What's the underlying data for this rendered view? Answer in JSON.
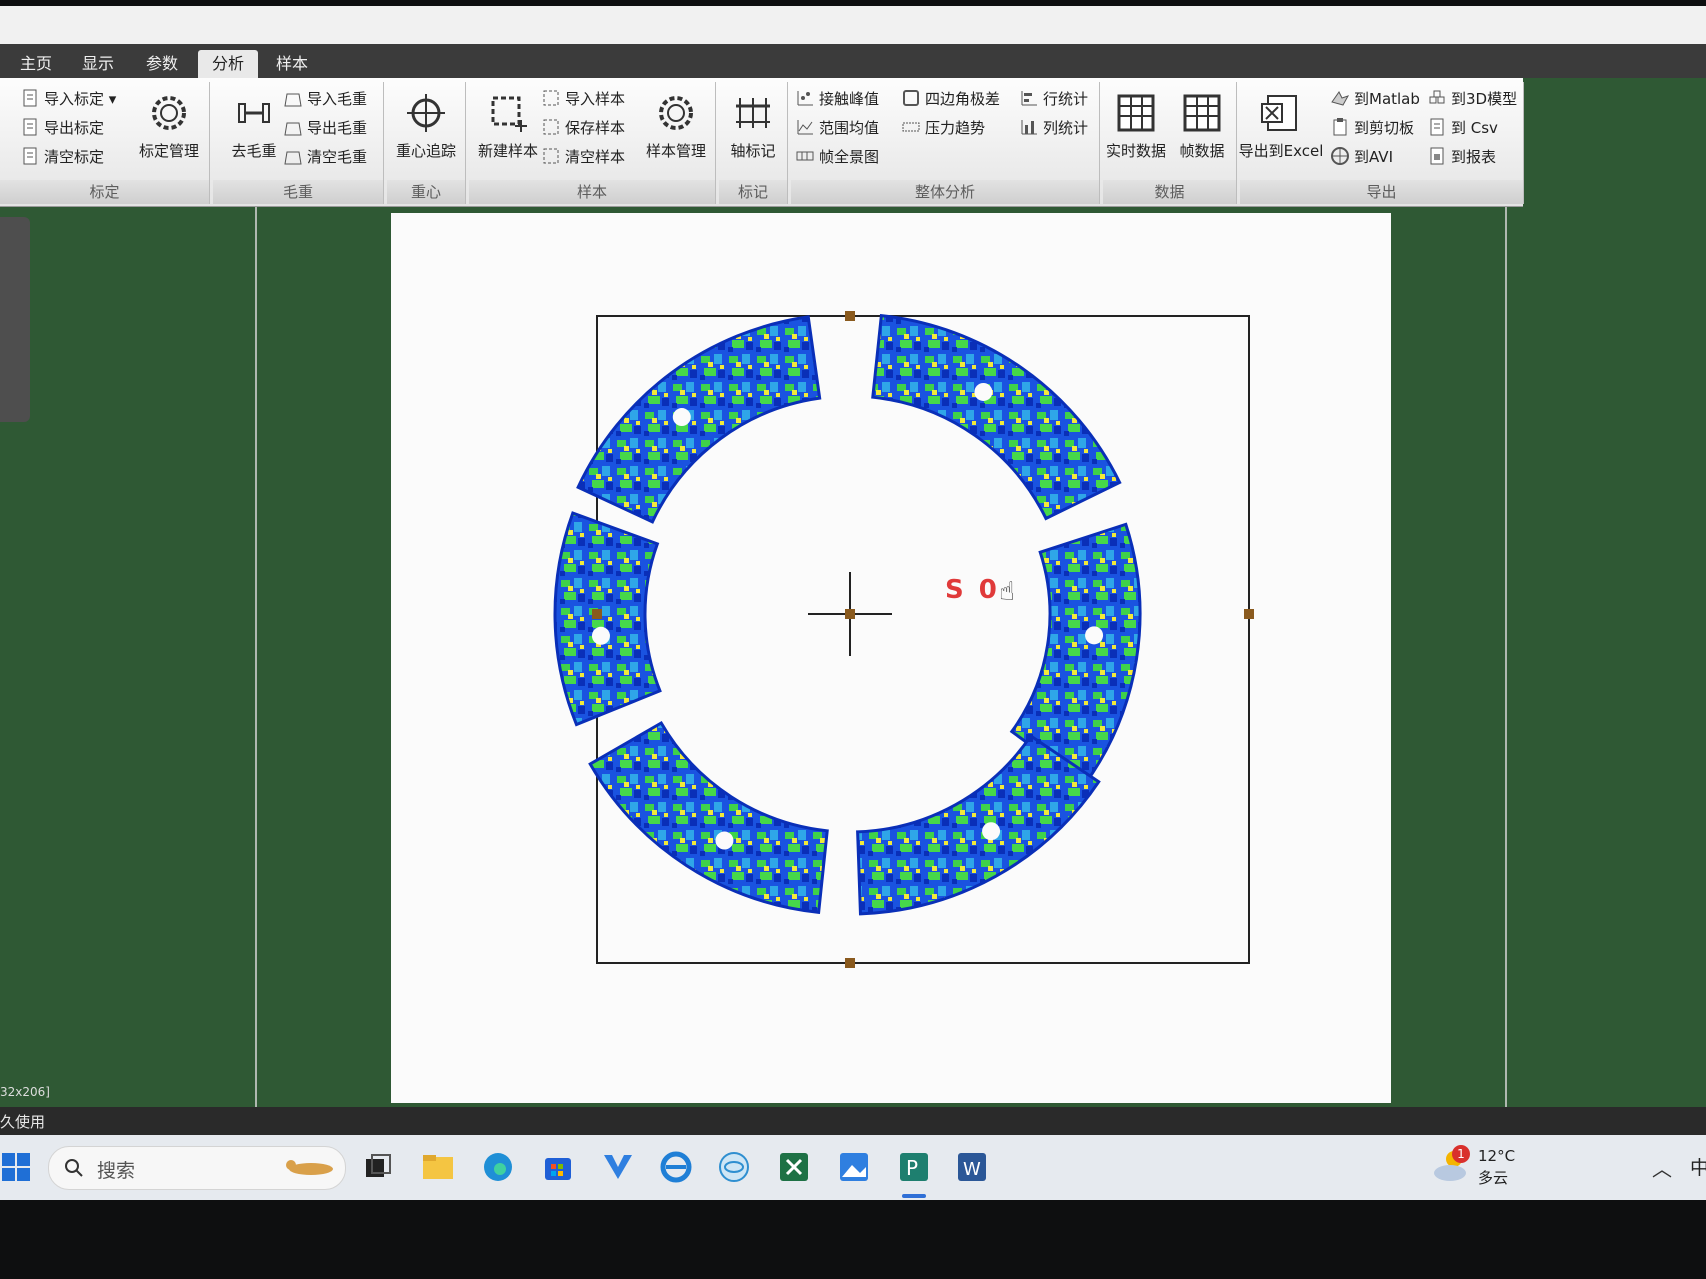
{
  "tabs": [
    "主页",
    "显示",
    "参数",
    "分析",
    "样本"
  ],
  "active_tab": "分析",
  "ribbon": {
    "calib": {
      "import": "导入标定",
      "export": "导出标定",
      "clear": "清空标定",
      "manage": "标定管理",
      "group": "标定"
    },
    "tare": {
      "remove": "去毛重",
      "import": "导入毛重",
      "export": "导出毛重",
      "clear": "清空毛重",
      "group": "毛重"
    },
    "cog": {
      "track": "重心追踪",
      "group": "重心"
    },
    "sample": {
      "new": "新建样本",
      "import": "导入样本",
      "save": "保存样本",
      "clear": "清空样本",
      "manage": "样本管理",
      "group": "样本"
    },
    "mark": {
      "axis": "轴标记",
      "group": "标记"
    },
    "whole": {
      "peak": "接触峰值",
      "range_avg": "范围均值",
      "frame_panorama": "帧全景图",
      "quad_diff": "四边角极差",
      "pressure_trend": "压力趋势",
      "row_stats": "行统计",
      "col_stats": "列统计",
      "group": "整体分析"
    },
    "data": {
      "realtime": "实时数据",
      "frame": "帧数据",
      "group": "数据"
    },
    "export": {
      "excel": "导出到Excel",
      "matlab": "到Matlab",
      "clipboard": "到剪切板",
      "avi": "到AVI",
      "model3d": "到3D模型",
      "csv": "到 Csv",
      "report": "到报表",
      "group": "导出"
    }
  },
  "canvas": {
    "marker_label": "S 0",
    "size_text": "32x206]"
  },
  "status_text": "久使用",
  "taskbar": {
    "search_placeholder": "搜索",
    "weather_temp": "12°C",
    "weather_cond": "多云",
    "badge": "1",
    "ime": "中"
  },
  "colors": {
    "accent_label": "#e03a3a",
    "heat_low": "#0a2fb8",
    "heat_mid": "#3fd14a",
    "heat_high": "#f2e93a"
  }
}
